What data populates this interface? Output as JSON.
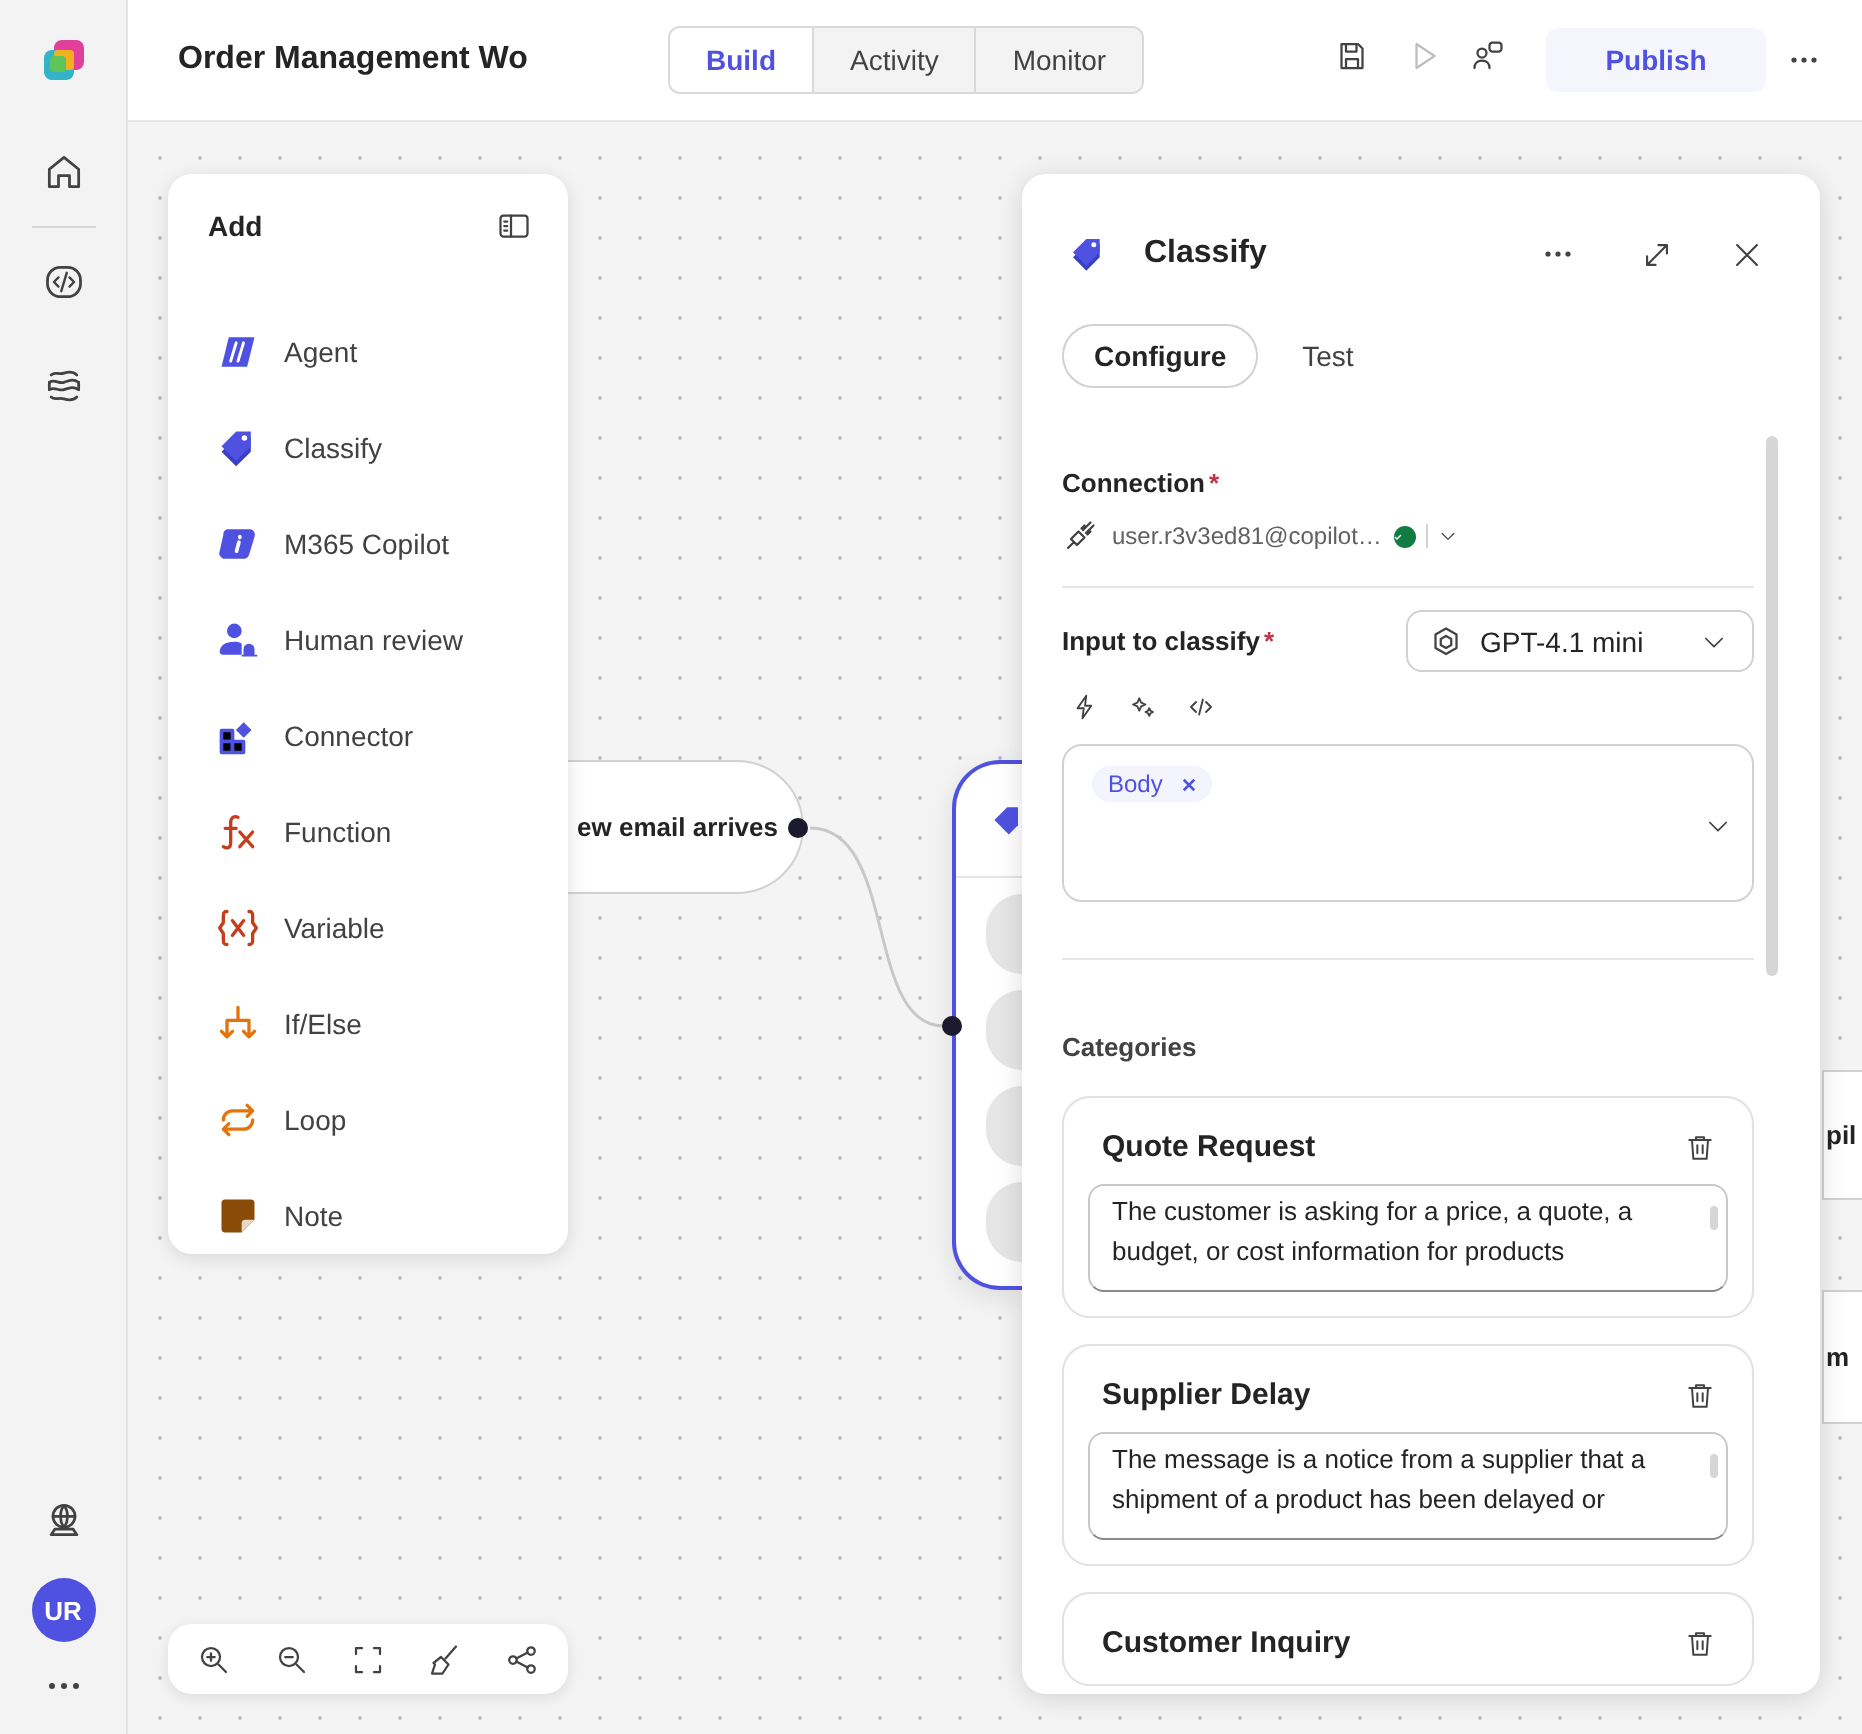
{
  "rail": {
    "avatar": "UR"
  },
  "top_bar": {
    "title": "Order Management Wo",
    "tabs": [
      {
        "label": "Build",
        "selected": true
      },
      {
        "label": "Activity",
        "selected": false
      },
      {
        "label": "Monitor",
        "selected": false
      }
    ],
    "publish_button": "Publish"
  },
  "canvas": {
    "nodes": [
      {
        "kind": "trigger",
        "label": "ew email arrives"
      },
      {
        "kind": "classify"
      },
      {
        "kind": "stub",
        "label": "pil"
      },
      {
        "kind": "stub",
        "label": "m"
      }
    ]
  },
  "add_panel": {
    "title": "Add",
    "items": [
      {
        "kind": "agent",
        "label": "Agent"
      },
      {
        "kind": "classify",
        "label": "Classify"
      },
      {
        "kind": "copilot",
        "label": "M365 Copilot"
      },
      {
        "kind": "human",
        "label": "Human review"
      },
      {
        "kind": "connector",
        "label": "Connector"
      },
      {
        "kind": "function",
        "label": "Function"
      },
      {
        "kind": "variable",
        "label": "Variable"
      },
      {
        "kind": "ifelse",
        "label": "If/Else"
      },
      {
        "kind": "loop",
        "label": "Loop"
      },
      {
        "kind": "note",
        "label": "Note"
      }
    ]
  },
  "classify_panel": {
    "title": "Classify",
    "tabs": [
      {
        "label": "Configure",
        "selected": true
      },
      {
        "label": "Test",
        "selected": false
      }
    ],
    "connection": {
      "label": "Connection",
      "required_mark": "*",
      "account": "user.r3v3ed81@copilot…",
      "connected": true
    },
    "input": {
      "label": "Input to classify",
      "required_mark": "*",
      "model": "GPT-4.1 mini",
      "tokens": [
        {
          "label": "Body"
        }
      ]
    },
    "categories_heading": "Categories",
    "categories": [
      {
        "name": "Quote Request",
        "description": "The customer is asking for a price, a quote, a budget, or cost information for products"
      },
      {
        "name": "Supplier Delay",
        "description": "The message is a notice from a supplier that a shipment of a product has been delayed or"
      },
      {
        "name": "Customer Inquiry"
      }
    ]
  }
}
